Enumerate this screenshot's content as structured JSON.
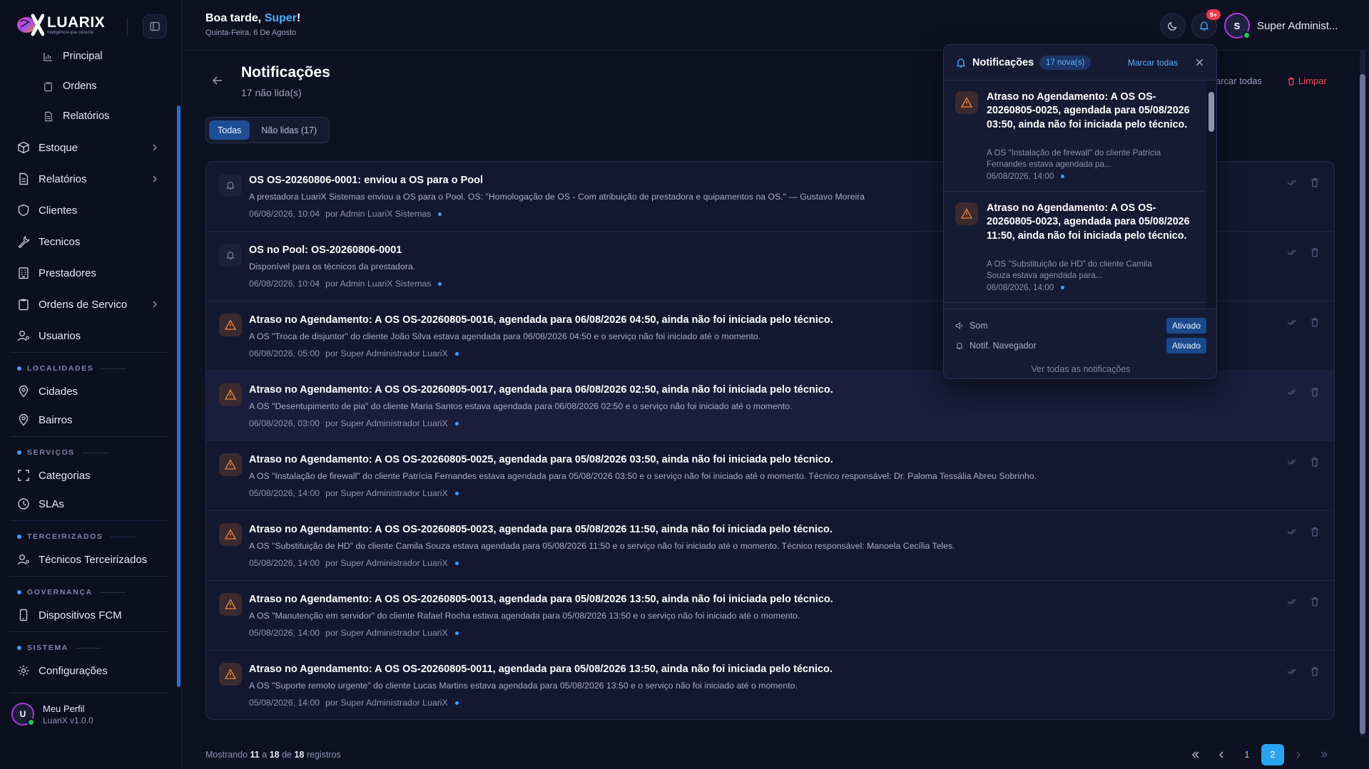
{
  "brand": {
    "name": "LUARIX",
    "tagline": "Inteligência que conecta"
  },
  "sidebar": {
    "subitems": [
      {
        "label": "Principal",
        "icon": "chart-icon"
      },
      {
        "label": "Ordens",
        "icon": "clipboard-icon"
      },
      {
        "label": "Relatórios",
        "icon": "file-icon"
      }
    ],
    "items": [
      {
        "label": "Estoque",
        "icon": "box-icon",
        "has_chevron": true
      },
      {
        "label": "Relatórios",
        "icon": "file-icon",
        "has_chevron": true
      },
      {
        "label": "Clientes",
        "icon": "shield-icon"
      },
      {
        "label": "Tecnicos",
        "icon": "wrench-icon"
      },
      {
        "label": "Prestadores",
        "icon": "building-icon"
      },
      {
        "label": "Ordens de Servico",
        "icon": "clipboard-icon",
        "has_chevron": true
      },
      {
        "label": "Usuarios",
        "icon": "user-gear-icon"
      }
    ],
    "sections": [
      {
        "title": "LOCALIDADES",
        "items": [
          {
            "label": "Cidades",
            "icon": "pin-icon"
          },
          {
            "label": "Bairros",
            "icon": "pin-icon"
          }
        ]
      },
      {
        "title": "SERVIÇOS",
        "items": [
          {
            "label": "Categorias",
            "icon": "expand-icon"
          },
          {
            "label": "SLAs",
            "icon": "clock-icon"
          }
        ]
      },
      {
        "title": "TERCEIRIZADOS",
        "items": [
          {
            "label": "Técnicos Terceirizados",
            "icon": "user-gear-icon"
          }
        ]
      },
      {
        "title": "GOVERNANÇA",
        "items": [
          {
            "label": "Dispositivos FCM",
            "icon": "phone-icon"
          }
        ]
      },
      {
        "title": "SISTEMA",
        "items": [
          {
            "label": "Configurações",
            "icon": "gear-icon"
          }
        ]
      }
    ],
    "profile": {
      "initial": "U",
      "name": "Meu Perfil",
      "version": "LuariX v1.0.0"
    }
  },
  "header": {
    "greeting_prefix": "Boa tarde, ",
    "greeting_name": "Super",
    "greeting_suffix": "!",
    "date": "Quinta-Feira, 6 De Agosto",
    "notif_badge": "9+",
    "user_initial": "S",
    "user_name": "Super Administ..."
  },
  "page": {
    "title": "Notificações",
    "subtitle": "17 não lida(s)",
    "mark_all": "arcar todas",
    "clear": "Limpar",
    "tabs": [
      {
        "label": "Todas",
        "active": true
      },
      {
        "label": "Não lidas (17)",
        "active": false
      }
    ]
  },
  "notifications": [
    {
      "type": "bell",
      "title": "OS OS-20260806-0001: enviou a OS para o Pool",
      "desc": "A prestadora LuariX Sistemas enviou a OS para o Pool. OS: \"Homologação de OS - Com atribuição de prestadora e quipamentos na OS.\" — Gustavo Moreira",
      "date": "06/08/2026, 10:04",
      "by": "por Admin LuariX Sistemas"
    },
    {
      "type": "bell",
      "title": "OS no Pool: OS-20260806-0001",
      "desc": "Disponível para os técnicos da prestadora.",
      "date": "06/08/2026, 10:04",
      "by": "por Admin LuariX Sistemas"
    },
    {
      "type": "warn",
      "title": "Atraso no Agendamento: A OS OS-20260805-0016, agendada para 06/08/2026 04:50, ainda não foi iniciada pelo técnico.",
      "desc": "A OS \"Troca de disjuntor\" do cliente João Silva estava agendada para 06/08/2026 04:50 e o serviço não foi iniciado até o momento.",
      "date": "06/08/2026, 05:00",
      "by": "por Super Administrador LuariX"
    },
    {
      "type": "warn",
      "title": "Atraso no Agendamento: A OS OS-20260805-0017, agendada para 06/08/2026 02:50, ainda não foi iniciada pelo técnico.",
      "desc": "A OS \"Desentupimento de pia\" do cliente Maria Santos estava agendada para 06/08/2026 02:50 e o serviço não foi iniciado até o momento.",
      "date": "06/08/2026, 03:00",
      "by": "por Super Administrador LuariX"
    },
    {
      "type": "warn",
      "title": "Atraso no Agendamento: A OS OS-20260805-0025, agendada para 05/08/2026 03:50, ainda não foi iniciada pelo técnico.",
      "desc": "A OS \"Instalação de firewall\" do cliente Patrícia Fernandes estava agendada para 05/08/2026 03:50 e o serviço não foi iniciado até o momento. Técnico responsável: Dr. Paloma Tessália Abreu Sobrinho.",
      "date": "05/08/2026, 14:00",
      "by": "por Super Administrador LuariX"
    },
    {
      "type": "warn",
      "title": "Atraso no Agendamento: A OS OS-20260805-0023, agendada para 05/08/2026 11:50, ainda não foi iniciada pelo técnico.",
      "desc": "A OS \"Substituição de HD\" do cliente Camila Souza estava agendada para 05/08/2026 11:50 e o serviço não foi iniciado até o momento. Técnico responsável: Manoela Cecília Teles.",
      "date": "05/08/2026, 14:00",
      "by": "por Super Administrador LuariX"
    },
    {
      "type": "warn",
      "title": "Atraso no Agendamento: A OS OS-20260805-0013, agendada para 05/08/2026 13:50, ainda não foi iniciada pelo técnico.",
      "desc": "A OS \"Manutenção em servidor\" do cliente Rafael Rocha estava agendada para 05/08/2026 13:50 e o serviço não foi iniciado até o momento.",
      "date": "05/08/2026, 14:00",
      "by": "por Super Administrador LuariX"
    },
    {
      "type": "warn",
      "title": "Atraso no Agendamento: A OS OS-20260805-0011, agendada para 05/08/2026 13:50, ainda não foi iniciada pelo técnico.",
      "desc": "A OS \"Suporte remoto urgente\" do cliente Lucas Martins estava agendada para 05/08/2026 13:50 e o serviço não foi iniciado até o momento.",
      "date": "05/08/2026, 14:00",
      "by": "por Super Administrador LuariX"
    }
  ],
  "footer": {
    "prefix": "Mostrando",
    "from": "11",
    "a": "a",
    "to": "18",
    "de": "de",
    "total": "18",
    "suffix": "registros",
    "pages": [
      "1",
      "2"
    ],
    "current_page": "2"
  },
  "dropdown": {
    "title": "Notificações",
    "count": "17 nova(s)",
    "mark_all": "Marcar todas",
    "items": [
      {
        "title": "Atraso no Agendamento: A OS OS-20260805-0025, agendada para 05/08/2026 03:50, ainda não foi iniciada pelo técnico.",
        "desc": "A OS \"Instalação de firewall\" do cliente Patrícia Fernandes estava agendada pa...",
        "time": "06/08/2026, 14:00"
      },
      {
        "title": "Atraso no Agendamento: A OS OS-20260805-0023, agendada para 05/08/2026 11:50, ainda não foi iniciada pelo técnico.",
        "desc": "A OS \"Substituição de HD\" do cliente Camila Souza estava agendada para...",
        "time": "06/08/2026, 14:00"
      }
    ],
    "settings": [
      {
        "label": "Som",
        "status": "Ativado",
        "icon": "speaker-icon"
      },
      {
        "label": "Notif. Navegador",
        "status": "Ativado",
        "icon": "bell-icon"
      }
    ],
    "view_all": "Ver todas as notificações"
  },
  "colors": {
    "accent": "#2aa3f0",
    "danger": "#ef3a4a",
    "warning": "#f0883e",
    "background": "#0d1122"
  }
}
